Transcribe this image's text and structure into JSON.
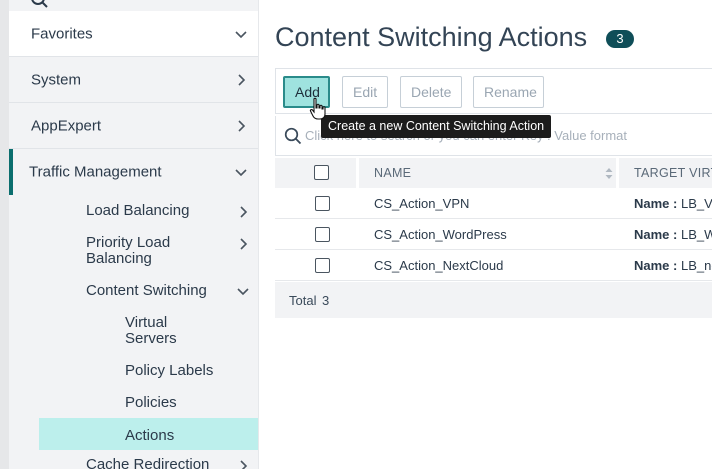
{
  "sidebar": {
    "favorites": "Favorites",
    "system": "System",
    "appexpert": "AppExpert",
    "traffic_management": "Traffic Management",
    "load_balancing": "Load Balancing",
    "priority_load_balancing": "Priority Load Balancing",
    "content_switching": "Content Switching",
    "virtual_servers": "Virtual Servers",
    "policy_labels": "Policy Labels",
    "policies": "Policies",
    "actions": "Actions",
    "cache_redirection": "Cache Redirection"
  },
  "page": {
    "title": "Content Switching Actions",
    "count": "3"
  },
  "toolbar": {
    "add": "Add",
    "edit": "Edit",
    "delete": "Delete",
    "rename": "Rename",
    "tooltip": "Create a new Content Switching Action"
  },
  "search": {
    "placeholder": "Click here to search or you can enter Key : Value format"
  },
  "table": {
    "headers": {
      "name": "NAME",
      "target": "TARGET VIRTU"
    },
    "rows": [
      {
        "name": "CS_Action_VPN",
        "target_label": "Name :",
        "target_value": "LB_VP"
      },
      {
        "name": "CS_Action_WordPress",
        "target_label": "Name :",
        "target_value": "LB_Wo"
      },
      {
        "name": "CS_Action_NextCloud",
        "target_label": "Name :",
        "target_value": "LB_ne"
      }
    ],
    "footer": {
      "total_label": "Total",
      "total_value": "3"
    }
  },
  "colors": {
    "accent": "#0b6e6e",
    "selected_bg": "#bcefec",
    "badge_bg": "#0f4e58",
    "primary_button_bg": "#9fe3df"
  }
}
